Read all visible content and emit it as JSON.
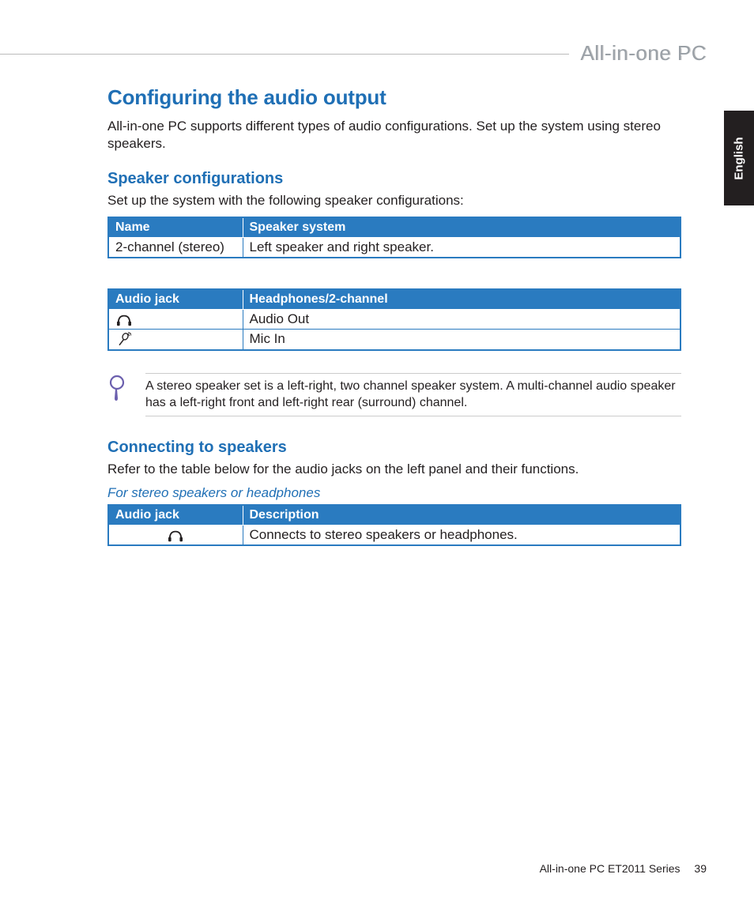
{
  "header": {
    "brand": "All-in-one PC",
    "language_tab": "English"
  },
  "title": "Configuring the audio output",
  "intro": "All-in-one PC supports different types of audio configurations. Set up the system using stereo speakers.",
  "section1": {
    "heading": "Speaker configurations",
    "lead": "Set up the system with the following speaker configurations:",
    "table1": {
      "head_name": "Name",
      "head_system": "Speaker system",
      "row1_name": "2-channel (stereo)",
      "row1_system": "Left speaker and right speaker."
    },
    "table2": {
      "head_jack": "Audio jack",
      "head_hp": "Headphones/2-channel",
      "row1_icon": "headphone-icon",
      "row1_val": "Audio Out",
      "row2_icon": "mic-icon",
      "row2_val": "Mic In"
    }
  },
  "note": {
    "icon": "magnifier-icon",
    "text": "A stereo speaker set is a left-right, two channel speaker system. A multi-channel audio speaker has a left-right front and left-right rear (surround) channel."
  },
  "section2": {
    "heading": "Connecting to speakers",
    "lead": "Refer to the table below for the audio jacks on the left panel and their functions.",
    "subhead": "For stereo speakers or headphones",
    "table": {
      "head_jack": "Audio jack",
      "head_desc": "Description",
      "row1_icon": "headphone-icon",
      "row1_desc": "Connects to stereo speakers or headphones."
    }
  },
  "footer": {
    "series": "All-in-one PC ET2011 Series",
    "page": "39"
  }
}
